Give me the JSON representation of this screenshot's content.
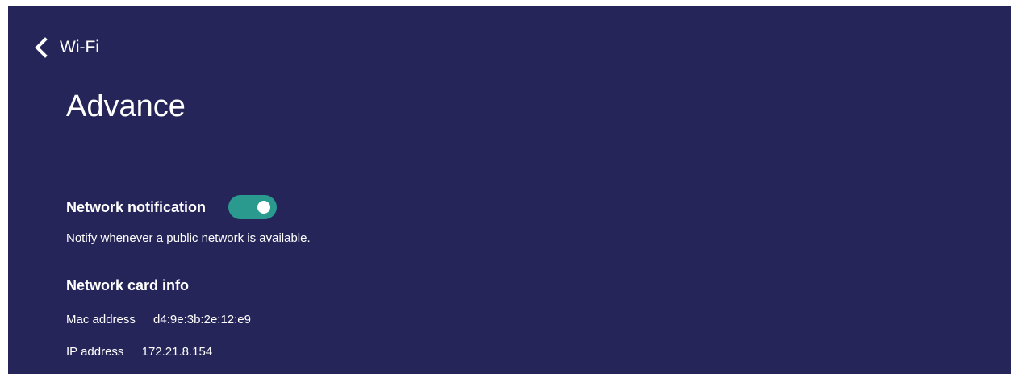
{
  "header": {
    "back_label": "Wi-Fi",
    "title": "Advance"
  },
  "network_notification": {
    "title": "Network notification",
    "description": "Notify whenever a public network is available.",
    "enabled": true,
    "toggle_color": "#2a9a8f"
  },
  "network_card_info": {
    "title": "Network card info",
    "mac_label": "Mac address",
    "mac_value": "d4:9e:3b:2e:12:e9",
    "ip_label": "IP address",
    "ip_value": "172.21.8.154"
  },
  "colors": {
    "background": "#25255a",
    "text": "#ffffff",
    "accent": "#2a9a8f"
  }
}
